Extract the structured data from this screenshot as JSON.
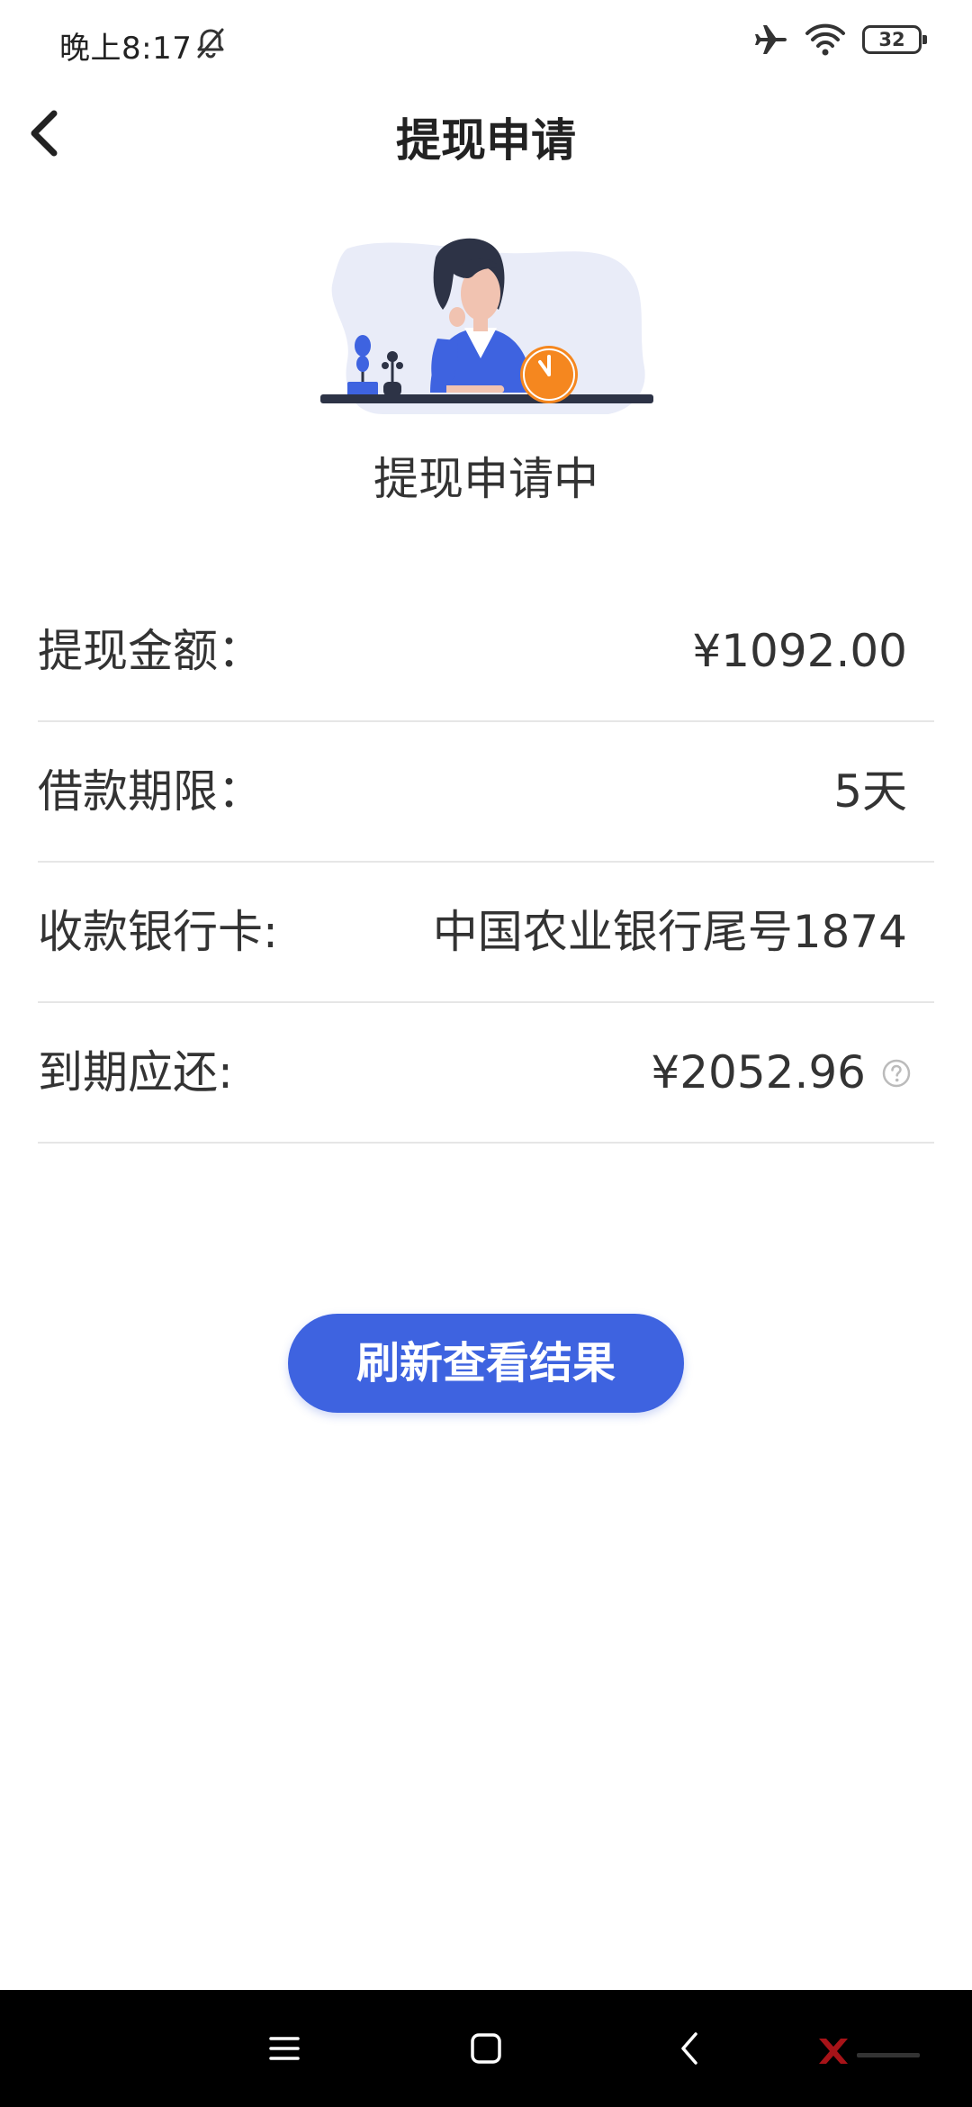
{
  "status_bar": {
    "time": "晚上8:17",
    "battery_level": "32",
    "icons": [
      "mute-icon",
      "airplane-icon",
      "wifi-icon",
      "battery-icon"
    ]
  },
  "header": {
    "title": "提现申请",
    "back_icon": "chevron-left-icon"
  },
  "status": {
    "label": "提现申请中",
    "illustration": "woman-at-desk-waiting-illustration"
  },
  "info": [
    {
      "label": "提现金额：",
      "value": "¥1092.00"
    },
    {
      "label": "借款期限：",
      "value": "5天"
    },
    {
      "label": "收款银行卡:",
      "value": "中国农业银行尾号1874"
    },
    {
      "label": "到期应还:",
      "value": "¥2052.96",
      "help_icon": "question-circle-icon"
    }
  ],
  "refresh_button": {
    "label": "刷新查看结果"
  },
  "nav_bar": {
    "icons": [
      "menu-icon",
      "home-square-icon",
      "back-chevron-icon"
    ]
  },
  "colors": {
    "accent": "#3e63e0",
    "clock_orange": "#f5871f",
    "nav_background": "#000000",
    "divider": "#e6e6e6"
  }
}
